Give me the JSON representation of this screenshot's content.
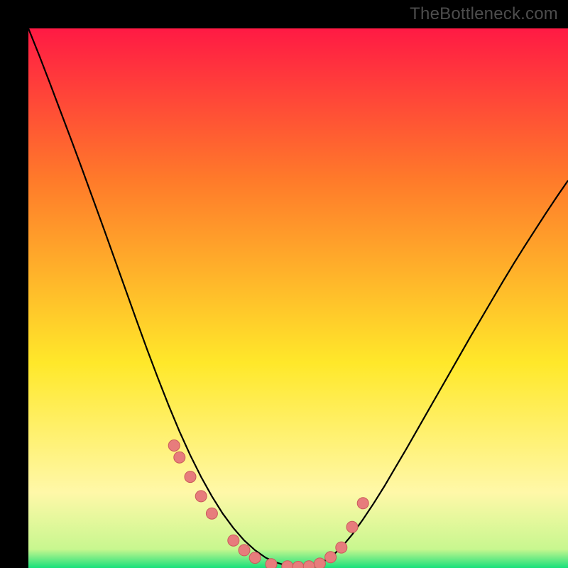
{
  "watermark": "TheBottleneck.com",
  "colors": {
    "black": "#000000",
    "curve": "#000000",
    "marker_fill": "#e77c7c",
    "marker_stroke": "#c95b5b",
    "gradient_top": "#ff1a44",
    "gradient_mid_upper": "#ff7a2a",
    "gradient_mid": "#ffe82a",
    "gradient_lower": "#fff8a8",
    "gradient_bottom": "#18e07b"
  },
  "chart_data": {
    "type": "line",
    "title": "",
    "xlabel": "",
    "ylabel": "",
    "xlim": [
      0,
      100
    ],
    "ylim": [
      0,
      100
    ],
    "x": [
      0,
      2,
      4,
      6,
      8,
      10,
      12,
      14,
      16,
      18,
      20,
      22,
      24,
      26,
      28,
      30,
      32,
      34,
      36,
      38,
      40,
      42,
      44,
      46,
      48,
      50,
      52,
      54,
      56,
      58,
      60,
      62,
      64,
      66,
      68,
      70,
      72,
      74,
      76,
      78,
      80,
      82,
      84,
      86,
      88,
      90,
      92,
      94,
      96,
      98,
      100
    ],
    "y": [
      100,
      95,
      89.8,
      84.5,
      79.2,
      73.8,
      68.3,
      62.8,
      57.2,
      51.6,
      46.0,
      40.5,
      35.2,
      30.1,
      25.3,
      20.9,
      16.9,
      13.3,
      10.1,
      7.4,
      5.1,
      3.3,
      1.9,
      1.0,
      0.4,
      0.2,
      0.3,
      0.8,
      2.0,
      3.8,
      6.2,
      9.0,
      12.0,
      15.2,
      18.6,
      22.0,
      25.5,
      29.0,
      32.5,
      36.0,
      39.5,
      43.0,
      46.4,
      49.8,
      53.2,
      56.5,
      59.7,
      62.8,
      65.9,
      68.9,
      71.8
    ],
    "markers_x": [
      27,
      28,
      30,
      32,
      34,
      38,
      40,
      42,
      45,
      48,
      50,
      52,
      54,
      56,
      58,
      60,
      62
    ],
    "markers_y": [
      22.7,
      20.5,
      16.9,
      13.3,
      10.1,
      5.1,
      3.3,
      1.9,
      0.7,
      0.3,
      0.2,
      0.3,
      0.8,
      2.0,
      3.8,
      7.6,
      12.0
    ],
    "gradient_stops": [
      {
        "offset": 0.0,
        "color": "#ff1a44"
      },
      {
        "offset": 0.28,
        "color": "#ff7a2a"
      },
      {
        "offset": 0.62,
        "color": "#ffe82a"
      },
      {
        "offset": 0.86,
        "color": "#fff8a8"
      },
      {
        "offset": 0.965,
        "color": "#c8f78f"
      },
      {
        "offset": 1.0,
        "color": "#18e07b"
      }
    ]
  }
}
